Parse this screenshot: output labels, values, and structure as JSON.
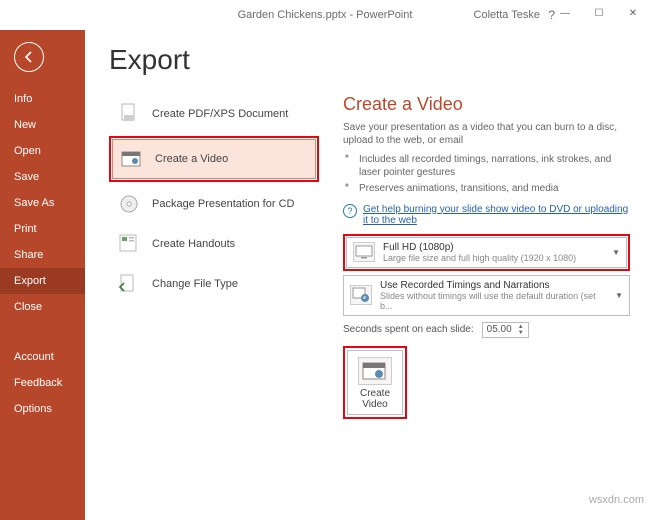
{
  "titlebar": {
    "document": "Garden Chickens.pptx - PowerPoint",
    "user": "Coletta Teske",
    "help": "?"
  },
  "window_controls": {
    "min": "—",
    "max": "☐",
    "close": "✕"
  },
  "rail": {
    "items": [
      "Info",
      "New",
      "Open",
      "Save",
      "Save As",
      "Print",
      "Share",
      "Export",
      "Close"
    ],
    "selected": "Export",
    "footer": [
      "Account",
      "Feedback",
      "Options"
    ]
  },
  "page_title": "Export",
  "export_options": [
    {
      "label": "Create PDF/XPS Document"
    },
    {
      "label": "Create a Video",
      "selected": true
    },
    {
      "label": "Package Presentation for CD"
    },
    {
      "label": "Create Handouts"
    },
    {
      "label": "Change File Type"
    }
  ],
  "detail": {
    "heading": "Create a Video",
    "desc": "Save your presentation as a video that you can burn to a disc, upload to the web, or email",
    "bullets": [
      "Includes all recorded timings, narrations, ink strokes, and laser pointer gestures",
      "Preserves animations, transitions, and media"
    ],
    "help_link": "Get help burning your slide show video to DVD or uploading it to the web",
    "quality": {
      "title": "Full HD (1080p)",
      "sub": "Large file size and full high quality (1920 x 1080)"
    },
    "timings": {
      "title": "Use Recorded Timings and Narrations",
      "sub": "Slides without timings will use the default duration (set b..."
    },
    "seconds_label": "Seconds spent on each slide:",
    "seconds_value": "05.00",
    "button_label": "Create\nVideo"
  },
  "watermark": "wsxdn.com"
}
